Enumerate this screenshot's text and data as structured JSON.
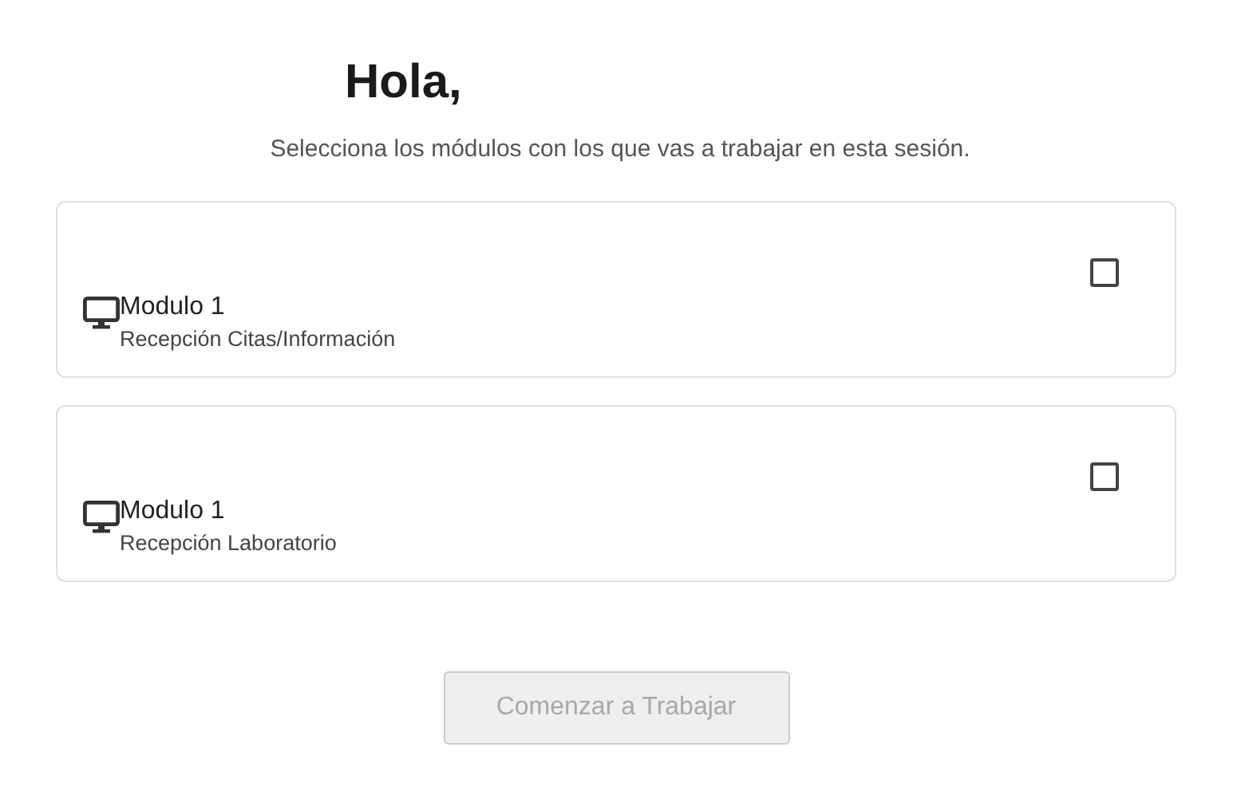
{
  "greeting": "Hola,",
  "subtitle": "Selecciona los módulos con los que vas a trabajar en esta sesión.",
  "modules": [
    {
      "name": "Modulo 1",
      "description": "Recepción Citas/Información",
      "checked": false
    },
    {
      "name": "Modulo 1",
      "description": "Recepción Laboratorio",
      "checked": false
    }
  ],
  "start_button": {
    "label": "Comenzar a Trabajar",
    "disabled": true
  }
}
